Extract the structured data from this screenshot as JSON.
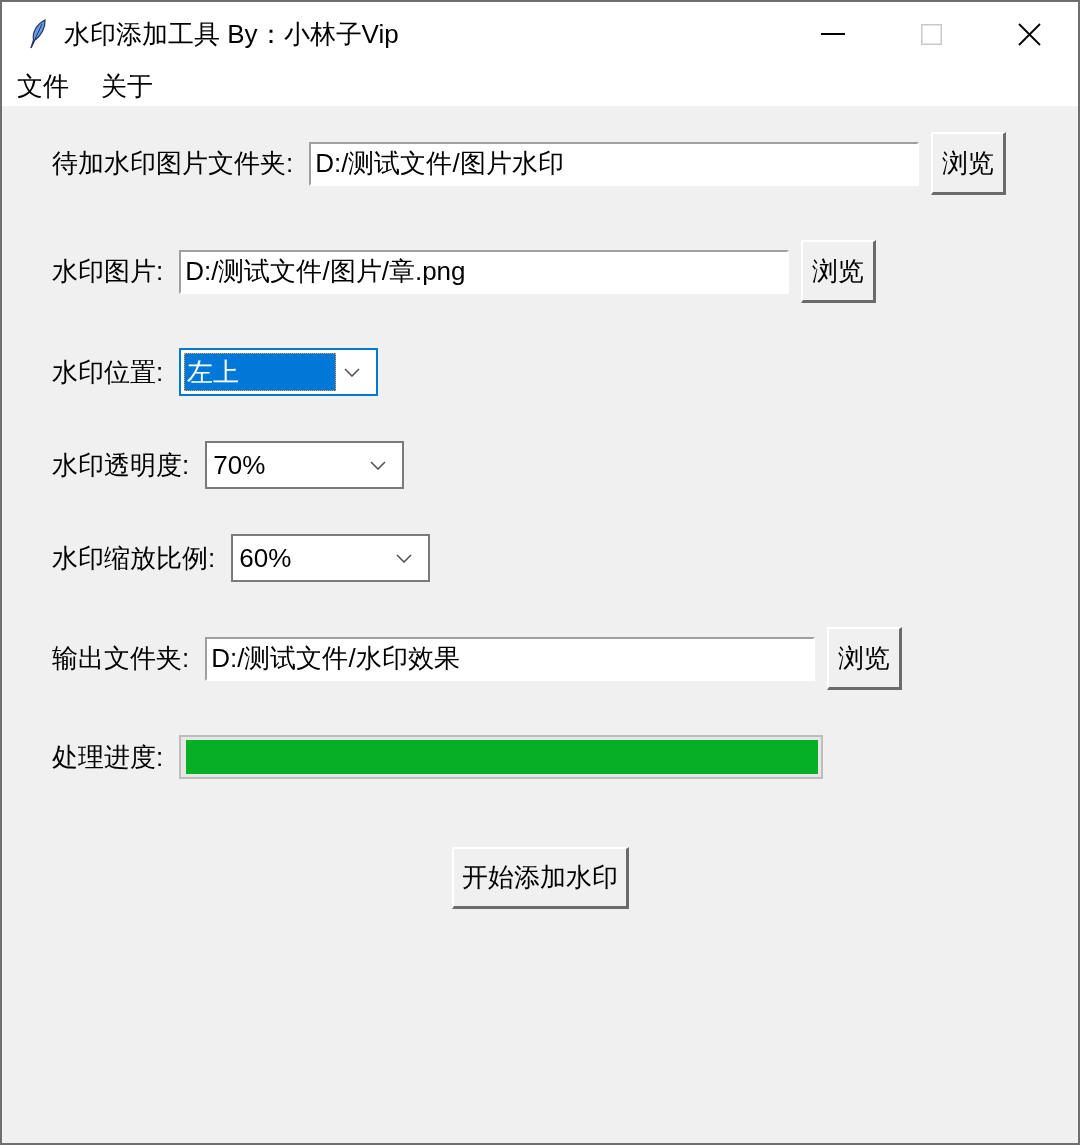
{
  "window": {
    "title": "水印添加工具 By：小林子Vip",
    "maximize_disabled": true
  },
  "menu": [
    "文件",
    "关于"
  ],
  "form": {
    "rows": [
      {
        "kind": "entry",
        "label": "待加水印图片文件夹:",
        "value": "D:/测试文件/图片水印",
        "button": "浏览"
      },
      {
        "kind": "entry",
        "label": "水印图片:",
        "value": "D:/测试文件/图片/章.png",
        "button": "浏览"
      },
      {
        "kind": "combo",
        "label": "水印位置:",
        "value": "左上",
        "focused": true
      },
      {
        "kind": "combo",
        "label": "水印透明度:",
        "value": "70%",
        "focused": false
      },
      {
        "kind": "combo",
        "label": "水印缩放比例:",
        "value": "60%",
        "focused": false
      },
      {
        "kind": "entry",
        "label": "输出文件夹:",
        "value": "D:/测试文件/水印效果",
        "button": "浏览"
      },
      {
        "kind": "progress",
        "label": "处理进度:",
        "level": 1
      }
    ],
    "start_button": "开始添加水印"
  }
}
